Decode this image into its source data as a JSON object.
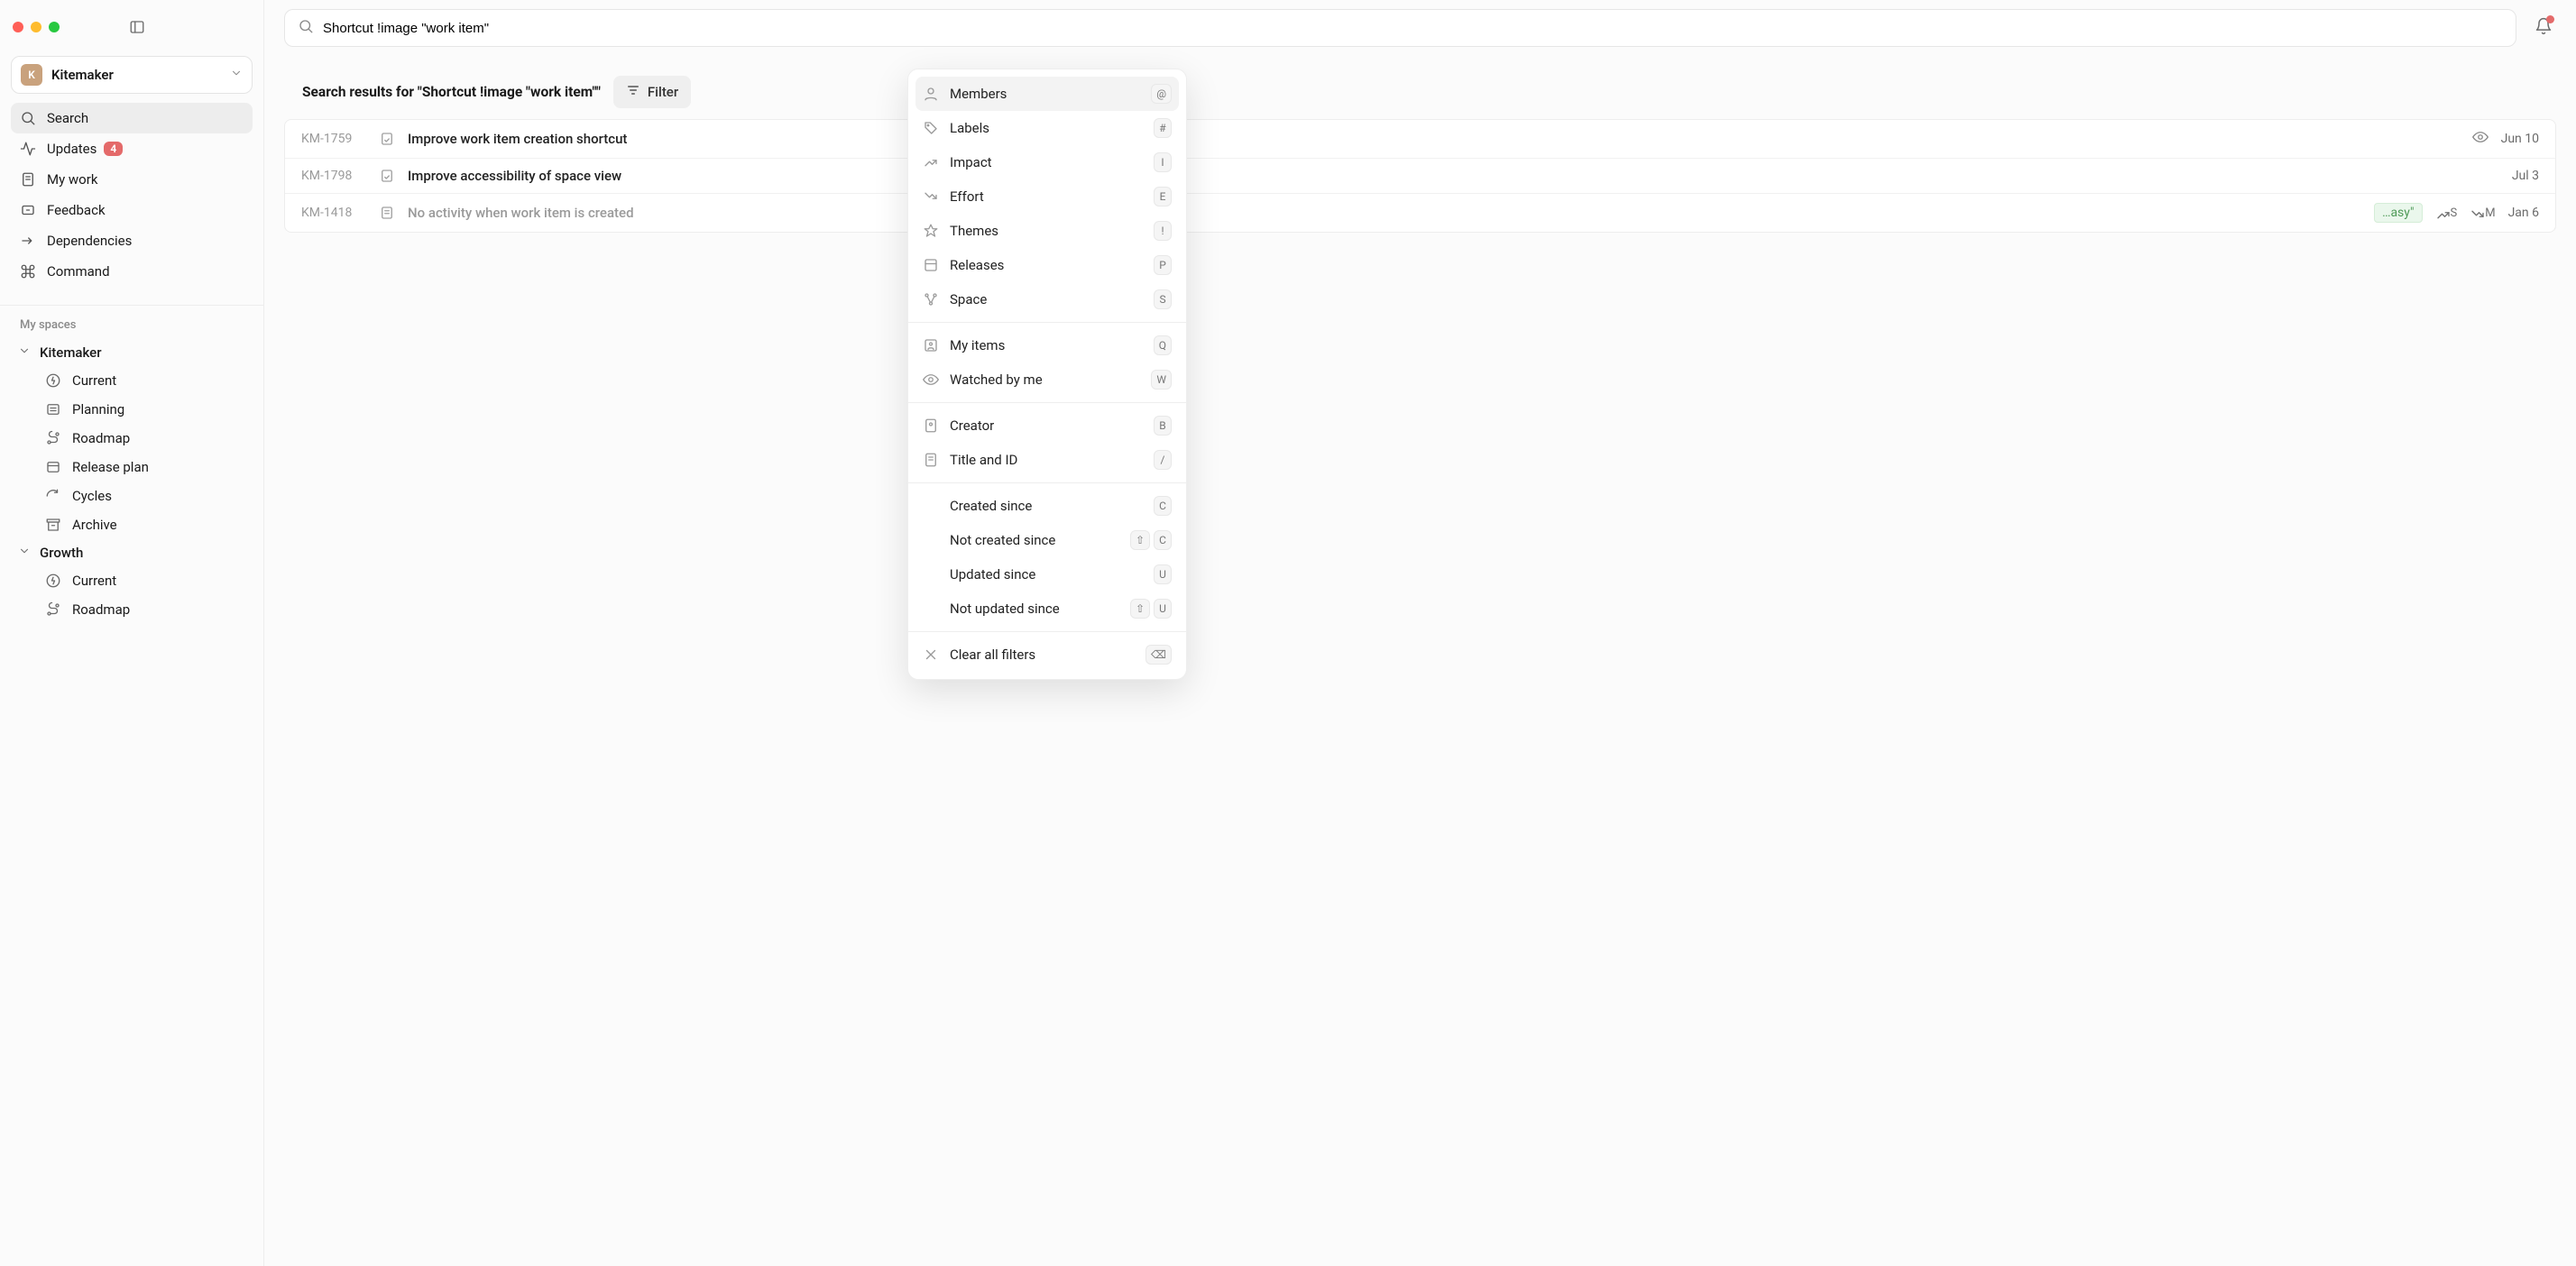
{
  "workspace": {
    "avatar_letter": "K",
    "name": "Kitemaker"
  },
  "search": {
    "value": "Shortcut !image \"work item\""
  },
  "nav": {
    "search": "Search",
    "updates": "Updates",
    "updates_badge": "4",
    "mywork": "My work",
    "feedback": "Feedback",
    "dependencies": "Dependencies",
    "command": "Command"
  },
  "spaces": {
    "label": "My spaces",
    "items": [
      {
        "name": "Kitemaker",
        "children": [
          "Current",
          "Planning",
          "Roadmap",
          "Release plan",
          "Cycles",
          "Archive"
        ]
      },
      {
        "name": "Growth",
        "children": [
          "Current",
          "Roadmap"
        ]
      }
    ]
  },
  "results": {
    "heading": "Search results for \"Shortcut !image \"work item\"\"",
    "filter_label": "Filter",
    "rows": [
      {
        "id": "KM-1759",
        "title": "Improve work item creation shortcut",
        "date": "Jun 10",
        "watched": true
      },
      {
        "id": "KM-1798",
        "title": "Improve accessibility of space view",
        "date": "Jul 3"
      },
      {
        "id": "KM-1418",
        "title": "No activity when work item is created",
        "date": "Jan 6",
        "pill": "…asy\"",
        "dim": true,
        "meta": [
          {
            "icon": "impact",
            "text": "S"
          },
          {
            "icon": "effort",
            "text": "M"
          }
        ]
      }
    ]
  },
  "filter_menu": {
    "groups": [
      [
        {
          "icon": "members",
          "label": "Members",
          "kbd": [
            "@"
          ],
          "hl": true
        },
        {
          "icon": "labels",
          "label": "Labels",
          "kbd": [
            "#"
          ]
        },
        {
          "icon": "impact",
          "label": "Impact",
          "kbd": [
            "I"
          ]
        },
        {
          "icon": "effort",
          "label": "Effort",
          "kbd": [
            "E"
          ]
        },
        {
          "icon": "themes",
          "label": "Themes",
          "kbd": [
            "!"
          ]
        },
        {
          "icon": "releases",
          "label": "Releases",
          "kbd": [
            "P"
          ]
        },
        {
          "icon": "space",
          "label": "Space",
          "kbd": [
            "S"
          ]
        }
      ],
      [
        {
          "icon": "myitems",
          "label": "My items",
          "kbd": [
            "Q"
          ]
        },
        {
          "icon": "watched",
          "label": "Watched by me",
          "kbd": [
            "W"
          ]
        }
      ],
      [
        {
          "icon": "creator",
          "label": "Creator",
          "kbd": [
            "B"
          ]
        },
        {
          "icon": "title",
          "label": "Title and ID",
          "kbd": [
            "/"
          ]
        }
      ],
      [
        {
          "label": "Created since",
          "kbd": [
            "C"
          ]
        },
        {
          "label": "Not created since",
          "kbd": [
            "⇧",
            "C"
          ]
        },
        {
          "label": "Updated since",
          "kbd": [
            "U"
          ]
        },
        {
          "label": "Not updated since",
          "kbd": [
            "⇧",
            "U"
          ]
        }
      ],
      [
        {
          "icon": "clear",
          "label": "Clear all filters",
          "kbd": [
            "⌫"
          ]
        }
      ]
    ]
  }
}
